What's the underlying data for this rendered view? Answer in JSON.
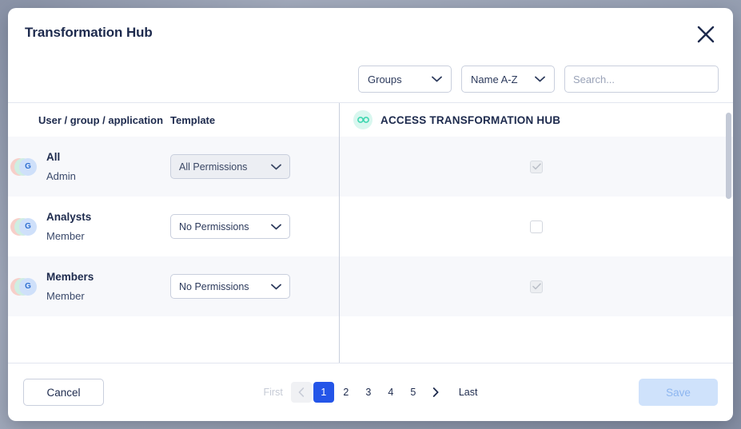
{
  "modal": {
    "title": "Transformation Hub",
    "close_icon": "close-icon"
  },
  "toolbar": {
    "entity_filter": {
      "value": "Groups",
      "icon": "chevron-down-icon"
    },
    "sort_filter": {
      "value": "Name A-Z",
      "icon": "chevron-down-icon"
    },
    "search": {
      "value": "",
      "placeholder": "Search...",
      "icon": "search-icon"
    }
  },
  "table": {
    "columns": {
      "subject": "User / group / application",
      "template": "Template"
    },
    "rows": [
      {
        "avatar_letter": "G",
        "name": "All",
        "role": "Admin",
        "template": "All Permissions",
        "template_disabled": true,
        "checked": true,
        "checkbox_disabled": true
      },
      {
        "avatar_letter": "G",
        "name": "Analysts",
        "role": "Member",
        "template": "No Permissions",
        "template_disabled": false,
        "checked": false,
        "checkbox_disabled": false
      },
      {
        "avatar_letter": "G",
        "name": "Members",
        "role": "Member",
        "template": "No Permissions",
        "template_disabled": true,
        "checked": true,
        "checkbox_disabled": true
      }
    ]
  },
  "app_column": {
    "name": "ACCESS TRANSFORMATION HUB",
    "icon": "goggles-icon",
    "icon_bg": "#d9f7ef",
    "icon_color": "#3fd6b0"
  },
  "footer": {
    "cancel_label": "Cancel",
    "save_label": "Save",
    "save_disabled": true,
    "pagination": {
      "first_label": "First",
      "prev_icon": "chevron-left-icon",
      "pages": [
        "1",
        "2",
        "3",
        "4",
        "5"
      ],
      "active_page": "1",
      "next_icon": "chevron-right-icon",
      "last_label": "Last"
    }
  },
  "colors": {
    "accent": "#2455e8",
    "title": "#1d2a4d",
    "border": "#c9cfdd",
    "row_alt": "#f7f8fb",
    "save_disabled_bg": "#cfe2fb"
  }
}
